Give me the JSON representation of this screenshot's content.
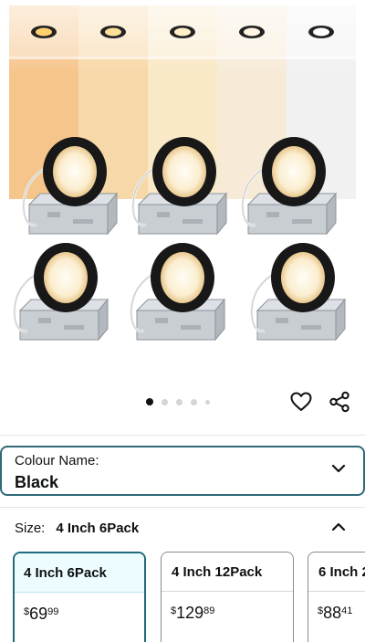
{
  "gallery": {
    "dots": {
      "count": 5,
      "active_index": 0
    },
    "colour_temperatures": [
      "#f6c58c",
      "#f7d8a8",
      "#f9e9c6",
      "#f7ebd8",
      "#f1f1f1"
    ]
  },
  "actions": {
    "heart_icon": "heart-outline",
    "share_icon": "share-nodes"
  },
  "colour": {
    "label": "Colour Name:",
    "value": "Black"
  },
  "size": {
    "label": "Size:",
    "value": "4 Inch 6Pack",
    "options": [
      {
        "name": "4 Inch 6Pack",
        "symbol": "$",
        "whole": "69",
        "fraction": "99",
        "selected": true
      },
      {
        "name": "4 Inch 12Pack",
        "symbol": "$",
        "whole": "129",
        "fraction": "89",
        "selected": false
      },
      {
        "name": "6 Inch 2",
        "symbol": "$",
        "whole": "88",
        "fraction": "41",
        "selected": false
      }
    ]
  },
  "colors": {
    "accent": "#2f6a78",
    "selected_bg": "#edfdff"
  }
}
